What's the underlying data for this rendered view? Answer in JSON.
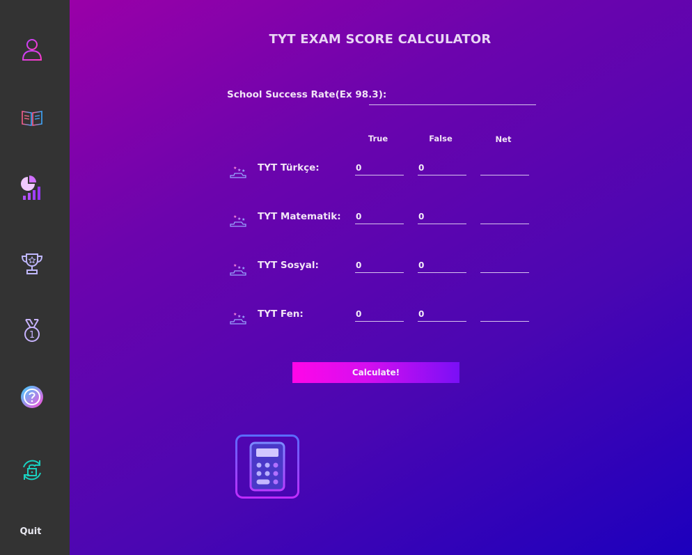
{
  "sidebar": {
    "items": [
      {
        "icon": "user-icon"
      },
      {
        "icon": "book-icon"
      },
      {
        "icon": "chart-icon"
      },
      {
        "icon": "trophy-icon"
      },
      {
        "icon": "medal-icon"
      },
      {
        "icon": "help-icon"
      },
      {
        "icon": "lock-refresh-icon"
      }
    ],
    "quit_label": "Quit"
  },
  "main": {
    "title": "TYT EXAM SCORE CALCULATOR",
    "school_rate": {
      "label": "School Success Rate(Ex 98.3):",
      "value": ""
    },
    "columns": [
      "True",
      "False",
      "Net"
    ],
    "subjects": [
      {
        "label": "TYT Türkçe:",
        "true": "0",
        "false": "0",
        "net": ""
      },
      {
        "label": "TYT Matematik:",
        "true": "0",
        "false": "0",
        "net": ""
      },
      {
        "label": "TYT Sosyal:",
        "true": "0",
        "false": "0",
        "net": ""
      },
      {
        "label": "TYT Fen:",
        "true": "0",
        "false": "0",
        "net": ""
      }
    ],
    "calculate_label": "Calculate!"
  },
  "colors": {
    "sidebar_bg": "#333333",
    "accent_pink": "#ff06e8",
    "accent_violet": "#7a0ff6"
  }
}
